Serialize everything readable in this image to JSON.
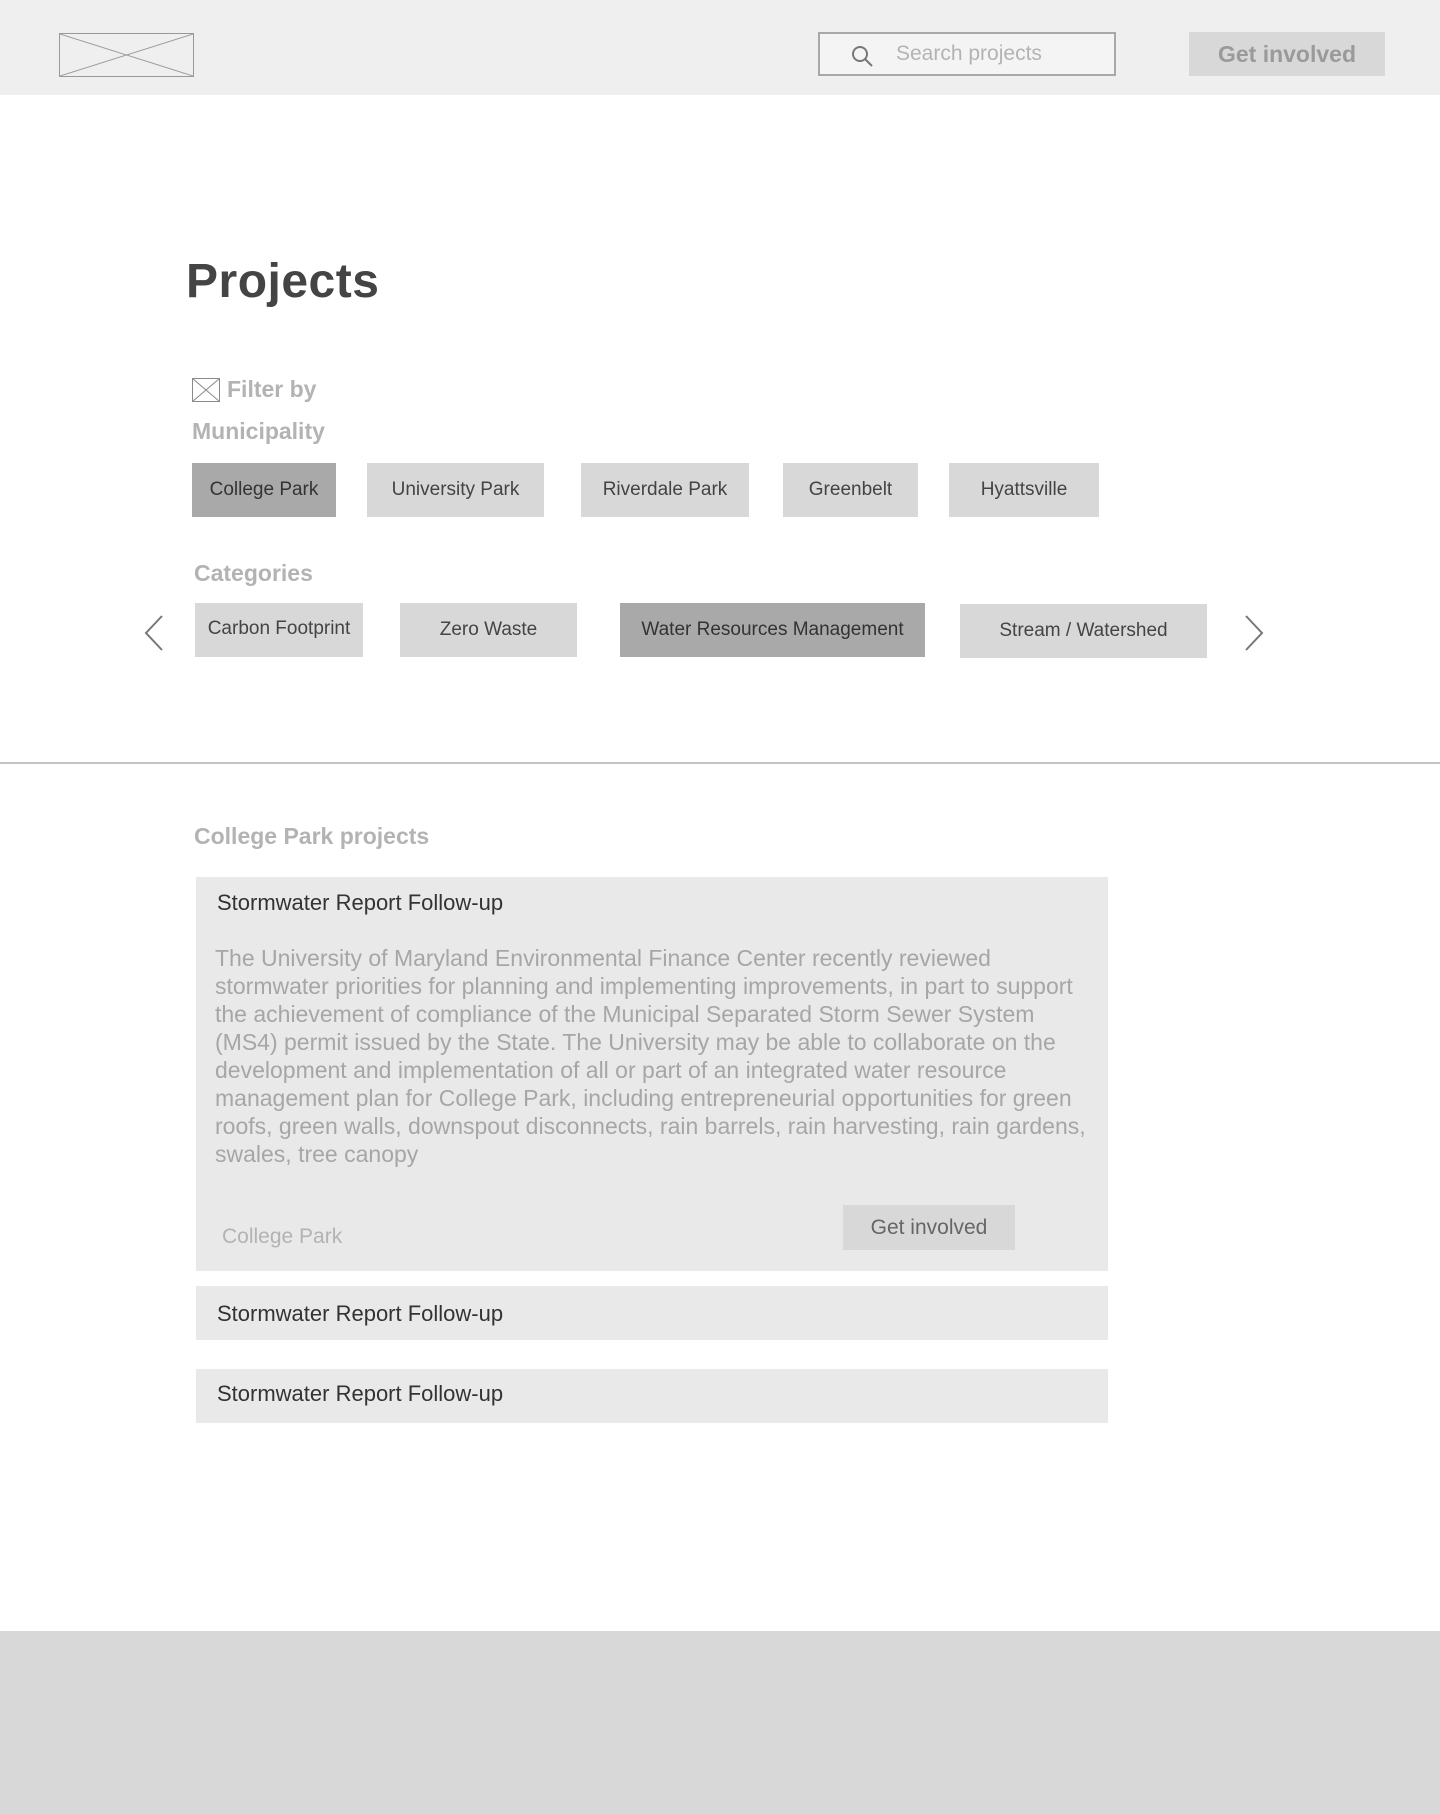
{
  "header": {
    "logo_icon": "image-placeholder-icon",
    "search": {
      "icon": "search-icon",
      "placeholder": "Search projects",
      "value": ""
    },
    "cta_label": "Get involved"
  },
  "page": {
    "title": "Projects"
  },
  "filter": {
    "icon": "image-placeholder-icon",
    "label": "Filter by",
    "municipality": {
      "label": "Municipality",
      "options": [
        {
          "label": "College Park",
          "selected": true
        },
        {
          "label": "University Park",
          "selected": false
        },
        {
          "label": "Riverdale Park",
          "selected": false
        },
        {
          "label": "Greenbelt",
          "selected": false
        },
        {
          "label": "Hyattsville",
          "selected": false
        }
      ]
    },
    "categories": {
      "label": "Categories",
      "prev_icon": "chevron-left-icon",
      "next_icon": "chevron-right-icon",
      "options": [
        {
          "label": "Carbon Footprint",
          "selected": false
        },
        {
          "label": "Zero Waste",
          "selected": false
        },
        {
          "label": "Water Resources Management",
          "selected": true
        },
        {
          "label": "Stream / Watershed",
          "selected": false
        }
      ]
    }
  },
  "results": {
    "title": "College Park projects",
    "projects": [
      {
        "title": "Stormwater Report Follow-up",
        "expanded": true,
        "body": "The University of Maryland Environmental Finance Center recently reviewed stormwater priorities for planning and implementing improvements, in part to support the achievement of compliance of the Municipal Separated Storm Sewer System (MS4) permit issued by the State.  The University may be able to collaborate on the development and implementation of all or part of an integrated water resource management plan for College Park, including entrepreneurial opportunities for green roofs, green walls, downspout disconnects, rain barrels, rain harvesting, rain gardens, swales, tree canopy",
        "location": "College Park",
        "cta_label": "Get involved"
      },
      {
        "title": "Stormwater Report Follow-up",
        "expanded": false
      },
      {
        "title": "Stormwater Report Follow-up",
        "expanded": false
      }
    ]
  },
  "colors": {
    "header_bg": "#efefef",
    "chip_bg": "#d8d8d8",
    "chip_selected_bg": "#a9a9a9",
    "card_bg": "#e9e9e9",
    "footer_bg": "#d8d8d8"
  }
}
